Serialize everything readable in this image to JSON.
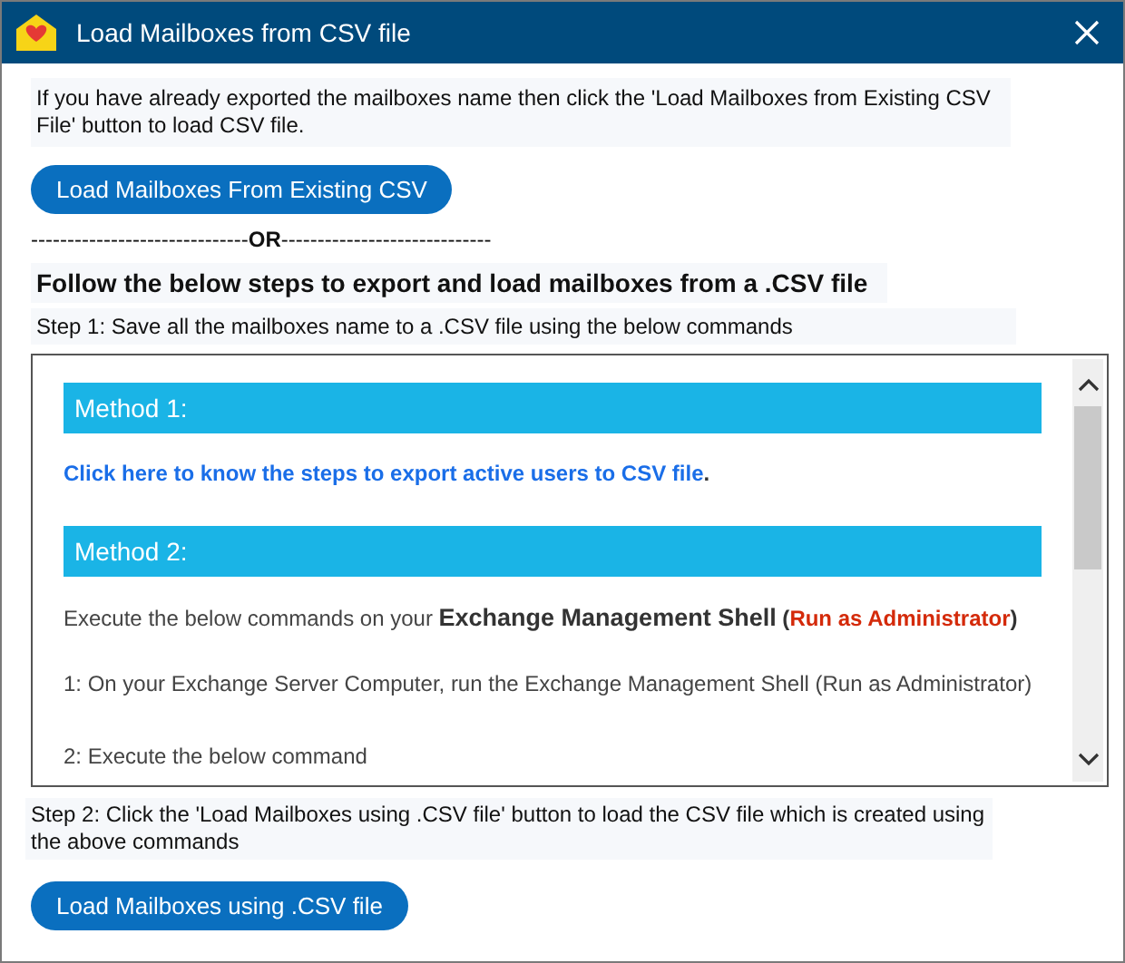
{
  "window": {
    "title": "Load Mailboxes from CSV file"
  },
  "intro": "If you have already exported the mailboxes name then click the 'Load Mailboxes from Existing CSV File' button to load CSV file.",
  "existing_button": "Load Mailboxes From Existing CSV",
  "separator": "------------------------------**OR**-----------------------------",
  "heading": "Follow the below steps to export and load mailboxes from a .CSV file",
  "step1": "Step 1: Save all the mailboxes name to a .CSV file using the below commands",
  "content": [
    {
      "kind": "header",
      "text": "Method 1:"
    },
    {
      "kind": "line",
      "parts": [
        {
          "kind": "link",
          "text": "Click here to know the steps to export active users to CSV file"
        },
        {
          "kind": "bold",
          "text": "."
        }
      ]
    },
    {
      "kind": "header",
      "text": "Method 2:"
    },
    {
      "kind": "line",
      "parts": [
        {
          "kind": "plain",
          "text": "Execute the below commands on your "
        },
        {
          "kind": "strong",
          "text": "Exchange Management Shell"
        },
        {
          "kind": "bold",
          "text": " ("
        },
        {
          "kind": "red",
          "text": "Run as Administrator"
        },
        {
          "kind": "bold",
          "text": ")"
        }
      ]
    },
    {
      "kind": "text",
      "text": "1: On your Exchange Server Computer, run the Exchange Management Shell (Run as Administrator)"
    },
    {
      "kind": "text",
      "text": "2: Execute the below command"
    }
  ],
  "step2": "Step 2: Click the 'Load Mailboxes using .CSV file' button to load the CSV file which is created using the above commands",
  "csv_button": "Load Mailboxes using .CSV file"
}
